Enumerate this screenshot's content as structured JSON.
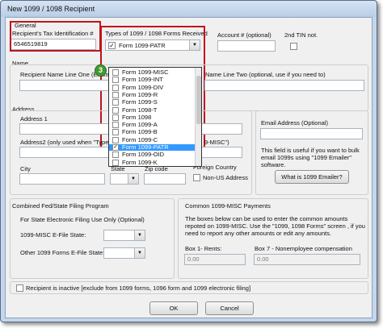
{
  "window": {
    "title": "New 1099 / 1098 Recipient"
  },
  "general": {
    "group_label": "General",
    "tin_label": "Recipient's Tax Identification #",
    "tin_value": "6546519819",
    "types_label": "Types of 1099 / 1098 Forms Received",
    "types_selected": "Form 1099-PATR",
    "account_label": "Account # (optional)",
    "second_tin_label": "2nd TIN not."
  },
  "step_badge": "3",
  "form_types": [
    {
      "label": "Form 1099-MISC",
      "checked": false,
      "highlighted": false
    },
    {
      "label": "Form 1099-INT",
      "checked": false,
      "highlighted": false
    },
    {
      "label": "Form 1099-DIV",
      "checked": false,
      "highlighted": false
    },
    {
      "label": "Form 1099-R",
      "checked": false,
      "highlighted": false
    },
    {
      "label": "Form 1099-S",
      "checked": false,
      "highlighted": false
    },
    {
      "label": "Form 1098-T",
      "checked": false,
      "highlighted": false
    },
    {
      "label": "Form 1098",
      "checked": false,
      "highlighted": false
    },
    {
      "label": "Form 1099-A",
      "checked": false,
      "highlighted": false
    },
    {
      "label": "Form 1099-B",
      "checked": false,
      "highlighted": false
    },
    {
      "label": "Form 1099-C",
      "checked": false,
      "highlighted": false
    },
    {
      "label": "Form 1099-PATR",
      "checked": true,
      "highlighted": true
    },
    {
      "label": "Form 1099-OID",
      "checked": false,
      "highlighted": false
    },
    {
      "label": "Form 1099-K",
      "checked": false,
      "highlighted": false
    }
  ],
  "name": {
    "group_label": "Name",
    "line_one_label": "Recipient Name Line One (Exam",
    "line_two_label": "Name Line Two (optional, use if you need to)"
  },
  "address": {
    "group_label": "Address",
    "address1_label": "Address 1",
    "address2_label": "Address2 (only used when \"Type",
    "address2_label_tail": "9-MISC\")",
    "city_label": "City",
    "state_label": "State",
    "zip_label": "Zip code",
    "country_label": "Foreign Country",
    "non_us_label": "Non-US Address"
  },
  "email": {
    "label": "Email Address (Optional)",
    "info": "This field is useful if you want to bulk email 1099s using \"1099 Emailer\" software.",
    "button": "What is 1099 Emailer?"
  },
  "state_filing": {
    "title": "Combined Fed/State Filing Program",
    "subtitle": "For State Electronic Filing Use Only (Optional)",
    "misc_label": "1099-MISC E-File State:",
    "other_label": "Other 1099 Forms E-File State:"
  },
  "misc_payments": {
    "title": "Common 1099-MISC Payments",
    "info": "The boxes below can be used to enter the common amounts repoted on 1099-MISC. Use the \"1099, 1098 Forms\" screen , if you need to report any other amounts or edit any amounts.",
    "box1_label": "Box 1- Rents:",
    "box1_value": "0.00",
    "box7_label": "Box 7 - Nonemployee compensation",
    "box7_value": "0.00"
  },
  "inactive_label": "Recipient is inactive [exclude from 1099 forms, 1096 form and 1099 electronic filing]",
  "buttons": {
    "ok": "OK",
    "cancel": "Cancel"
  },
  "colors": {
    "annotation_red": "#c0141c",
    "badge_green": "#3f9a2f",
    "selection_blue": "#3399ff"
  }
}
